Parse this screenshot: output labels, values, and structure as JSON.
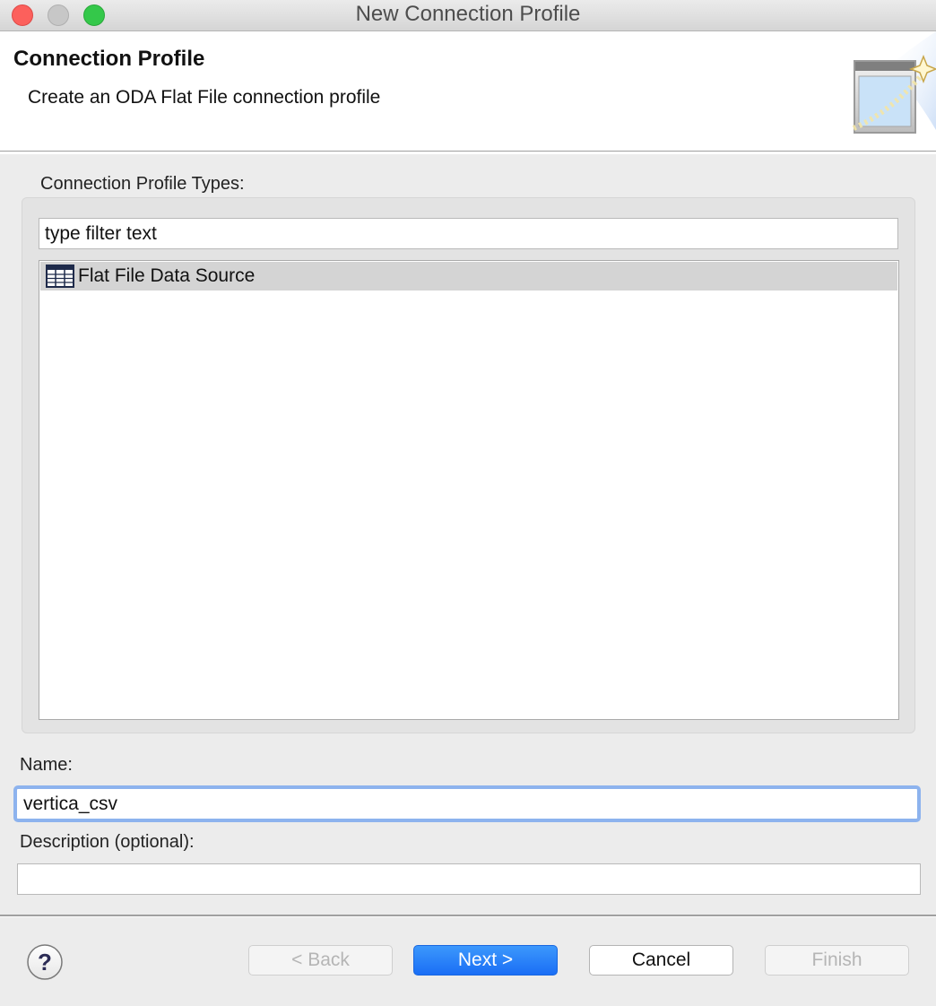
{
  "window": {
    "title": "New Connection Profile"
  },
  "banner": {
    "title": "Connection Profile",
    "description": "Create an ODA Flat File connection profile",
    "icon": "wizard-icon"
  },
  "types": {
    "label": "Connection Profile Types:",
    "filter_value": "type filter text",
    "items": [
      {
        "label": "Flat File Data Source",
        "icon": "flat-file-table-icon",
        "selected": true
      }
    ]
  },
  "name_field": {
    "label": "Name:",
    "value": "vertica_csv"
  },
  "description_field": {
    "label": "Description (optional):",
    "value": ""
  },
  "buttons": {
    "help": "help-icon",
    "back": "< Back",
    "next": "Next >",
    "cancel": "Cancel",
    "finish": "Finish"
  },
  "colors": {
    "accent": "#1a6ef5",
    "focus_ring": "#8db3ee",
    "selection": "#d4d4d4"
  }
}
